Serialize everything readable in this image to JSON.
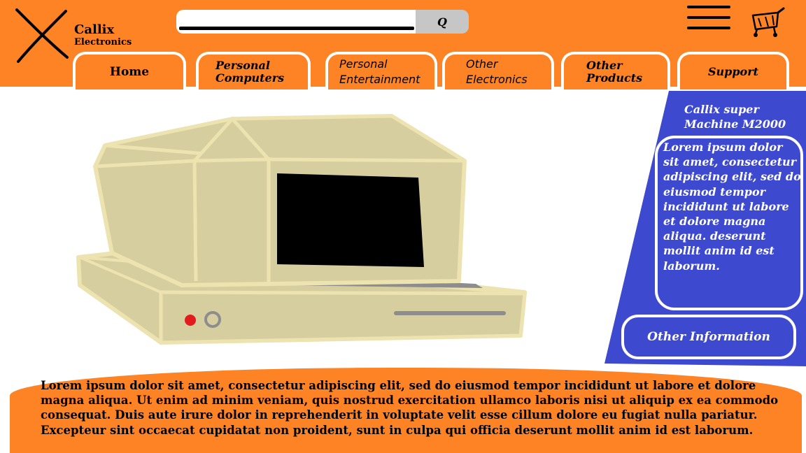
{
  "brand": {
    "name": "Callix",
    "subtitle": "Electronics"
  },
  "search": {
    "value": "",
    "placeholder": "",
    "button_label": "Q"
  },
  "header_icons": {
    "menu": "hamburger-icon",
    "cart": "shopping-cart-icon"
  },
  "nav": {
    "tabs": [
      {
        "label": "Home"
      },
      {
        "label": "Personal Computers"
      },
      {
        "label": "Personal Entertainment"
      },
      {
        "label": "Other Electronics"
      },
      {
        "label": "Other Products"
      },
      {
        "label": "Support"
      }
    ]
  },
  "hero": {
    "image": "retro-computer-illustration"
  },
  "sidebar": {
    "product_title": "Callix super Machine M2000",
    "description": "Lorem ipsum dolor sit amet, consectetur adipiscing elit, sed do eiusmod tempor incididunt ut labore et dolore magna aliqua. deserunt mollit anim id est laborum.",
    "other_info_label": "Other Information"
  },
  "footer": {
    "text": "Lorem ipsum dolor sit amet, consectetur adipiscing elit, sed do eiusmod tempor incididunt ut labore et dolore magna aliqua. Ut enim ad minim veniam, quis nostrud exercitation ullamco laboris nisi ut aliquip ex ea commodo consequat. Duis aute irure dolor in reprehenderit in voluptate velit esse cillum dolore eu fugiat nulla pariatur. Excepteur sint occaecat cupidatat non proident, sunt in culpa qui officia deserunt mollit anim id est laborum."
  },
  "colors": {
    "orange": "#fd8325",
    "sidebar_blue": "#3d49cf",
    "computer_beige": "#d7ce9f",
    "computer_outline": "#ece3b0",
    "screen": "#000000",
    "search_button": "#c6c6c6"
  }
}
